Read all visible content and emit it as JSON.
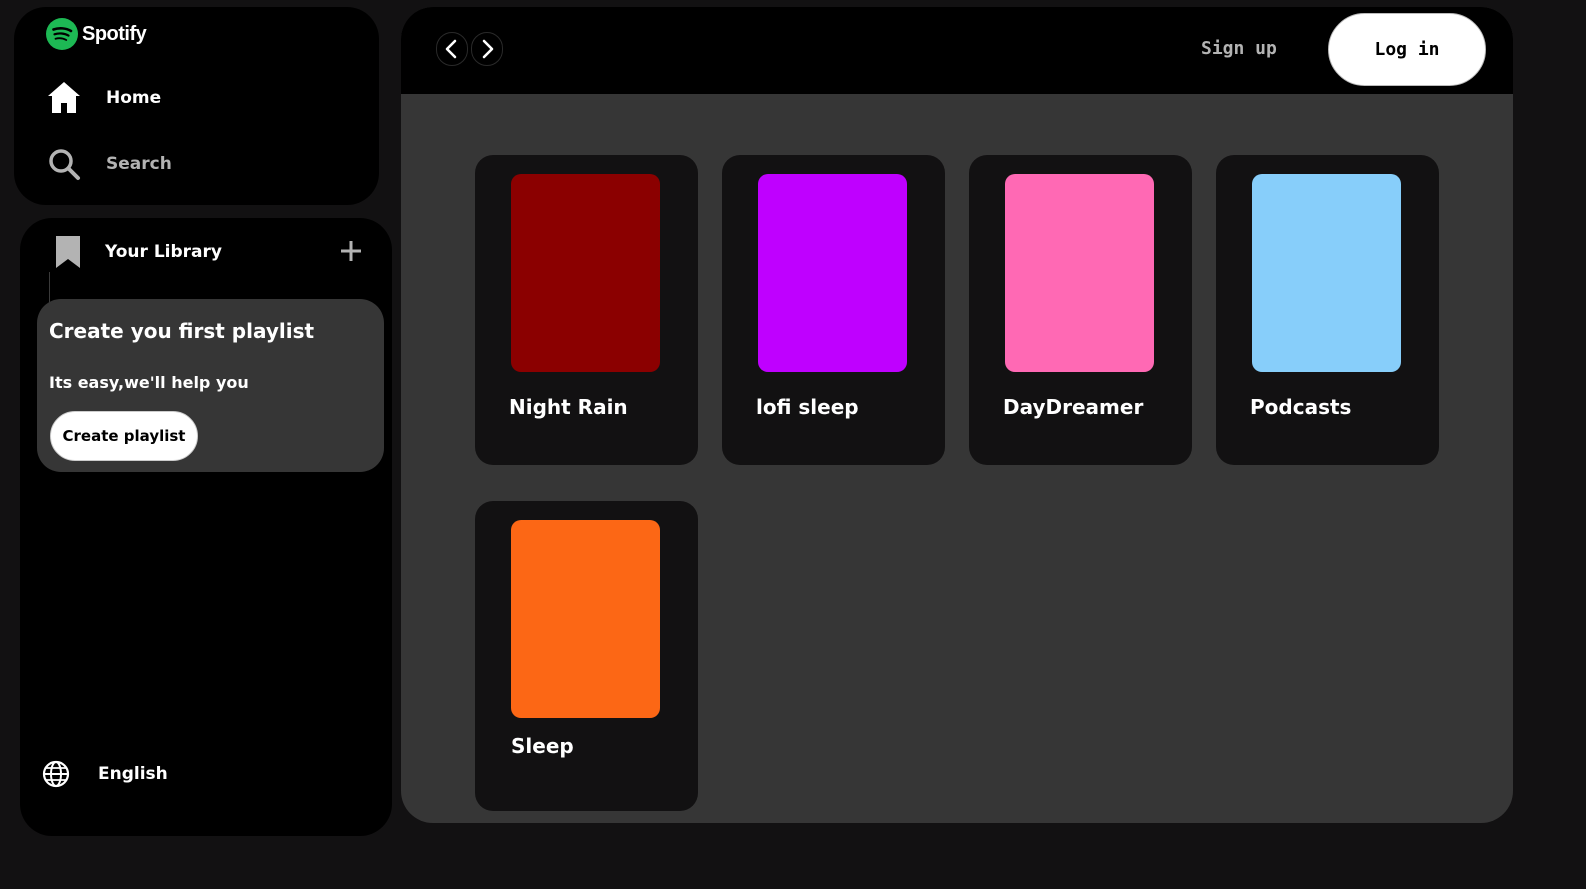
{
  "brand": {
    "name": "Spotify",
    "accent_color": "#1DB954"
  },
  "nav": {
    "items": [
      {
        "label": "Home",
        "icon": "home-icon"
      },
      {
        "label": "Search",
        "icon": "search-icon"
      }
    ]
  },
  "library": {
    "title": "Your Library",
    "add_icon": "plus-icon",
    "prompt_card": {
      "title": "Create you first playlist",
      "subtitle": "Its easy,we'll help you",
      "button_label": "Create playlist"
    },
    "language": {
      "label": "English",
      "icon": "globe-icon"
    }
  },
  "topbar": {
    "back_icon": "chevron-left-icon",
    "forward_icon": "chevron-right-icon",
    "signup_label": "Sign up",
    "login_label": "Log in"
  },
  "cards": [
    {
      "title": "Night Rain",
      "color": "#8B0000"
    },
    {
      "title": "lofi sleep",
      "color": "#BF00FF"
    },
    {
      "title": "DayDreamer",
      "color": "#FF69B4"
    },
    {
      "title": "Podcasts",
      "color": "#87CEFA"
    },
    {
      "title": "Sleep",
      "color": "#FC6715"
    }
  ]
}
